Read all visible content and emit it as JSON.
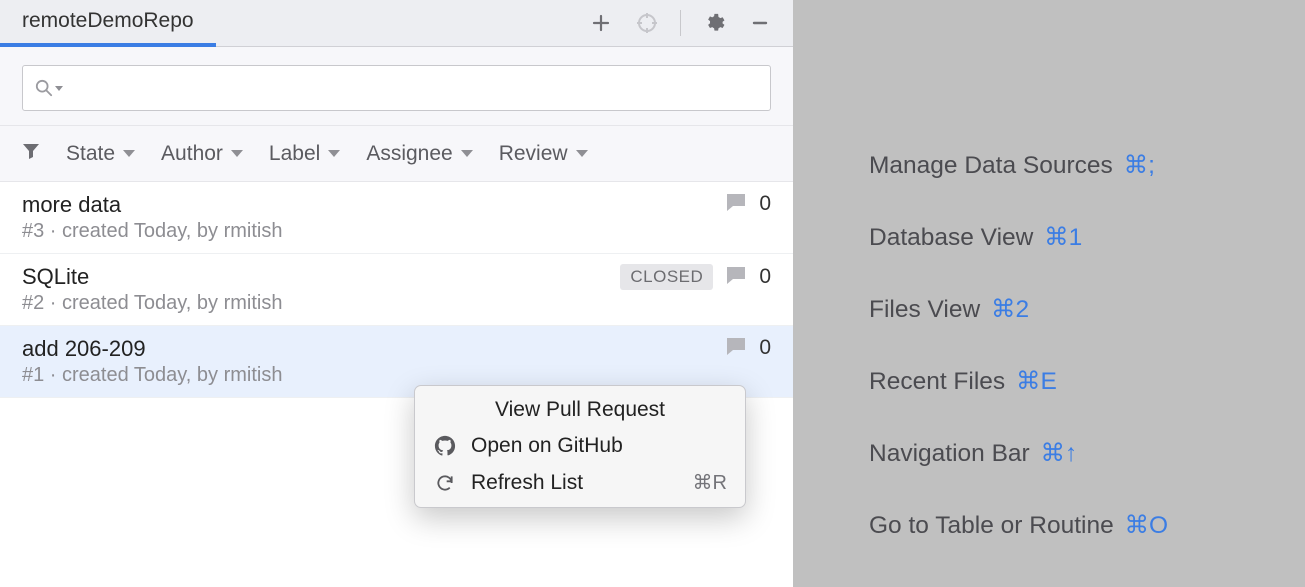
{
  "header": {
    "tab": "remoteDemoRepo"
  },
  "search": {
    "placeholder": ""
  },
  "filters": {
    "state": "State",
    "author": "Author",
    "label": "Label",
    "assignee": "Assignee",
    "review": "Review"
  },
  "pull_requests": [
    {
      "title": "more data",
      "meta": "#3 · created Today, by rmitish",
      "count": "0",
      "closed": false
    },
    {
      "title": "SQLite",
      "meta": "#2 · created Today, by rmitish",
      "count": "0",
      "closed": true
    },
    {
      "title": "add 206-209",
      "meta": "#1 · created Today, by rmitish",
      "count": "0",
      "closed": false
    }
  ],
  "closed_label": "CLOSED",
  "context_menu": {
    "view": "View Pull Request",
    "open_github": "Open on GitHub",
    "refresh": "Refresh List",
    "refresh_shortcut": "⌘R"
  },
  "side_links": [
    {
      "label": "Manage Data Sources",
      "shortcut": "⌘;"
    },
    {
      "label": "Database View",
      "shortcut": "⌘1"
    },
    {
      "label": "Files View",
      "shortcut": "⌘2"
    },
    {
      "label": "Recent Files",
      "shortcut": "⌘E"
    },
    {
      "label": "Navigation Bar",
      "shortcut": "⌘↑"
    },
    {
      "label": "Go to Table or Routine",
      "shortcut": "⌘O"
    }
  ]
}
